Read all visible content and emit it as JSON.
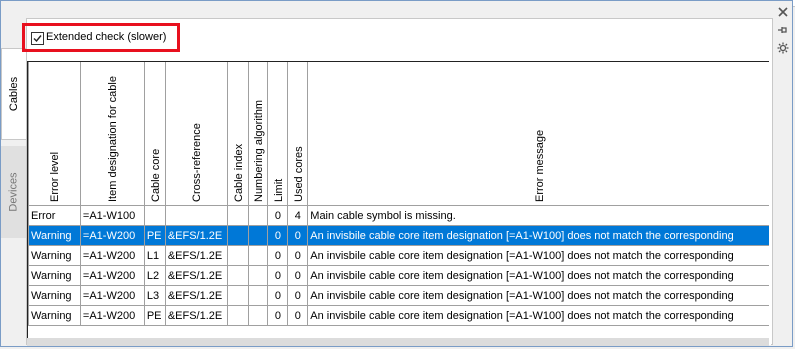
{
  "window": {
    "close_glyph": "✕"
  },
  "tabs": {
    "cables": "Cables",
    "devices": "Devices"
  },
  "options": {
    "extended_check_label": "Extended check (slower)",
    "extended_check_checked": true
  },
  "table": {
    "columns": [
      "Error level",
      "Item designation for cable",
      "Cable core",
      "Cross-reference",
      "Cable index",
      "Numbering algorithm",
      "Limit",
      "Used cores",
      "Error message"
    ],
    "rows": [
      [
        "Error",
        "=A1-W100",
        "",
        "",
        "",
        "",
        "0",
        "4",
        "Main cable symbol is missing."
      ],
      [
        "Warning",
        "=A1-W200",
        "PE",
        "&EFS/1.2E",
        "",
        "",
        "0",
        "0",
        "An invisbile cable core item designation [=A1-W100] does not match the corresponding"
      ],
      [
        "Warning",
        "=A1-W200",
        "L1",
        "&EFS/1.2E",
        "",
        "",
        "0",
        "0",
        "An invisbile cable core item designation [=A1-W100] does not match the corresponding"
      ],
      [
        "Warning",
        "=A1-W200",
        "L2",
        "&EFS/1.2E",
        "",
        "",
        "0",
        "0",
        "An invisbile cable core item designation [=A1-W100] does not match the corresponding"
      ],
      [
        "Warning",
        "=A1-W200",
        "L3",
        "&EFS/1.2E",
        "",
        "",
        "0",
        "0",
        "An invisbile cable core item designation [=A1-W100] does not match the corresponding"
      ],
      [
        "Warning",
        "=A1-W200",
        "PE",
        "&EFS/1.2E",
        "",
        "",
        "0",
        "0",
        "An invisbile cable core item designation [=A1-W100] does not match the corresponding"
      ]
    ],
    "selected_row": 1
  },
  "right_icons": [
    "close-icon",
    "pin-icon",
    "settings-icon"
  ],
  "colors": {
    "highlight": "#e8101e",
    "selection": "#0078d7"
  }
}
